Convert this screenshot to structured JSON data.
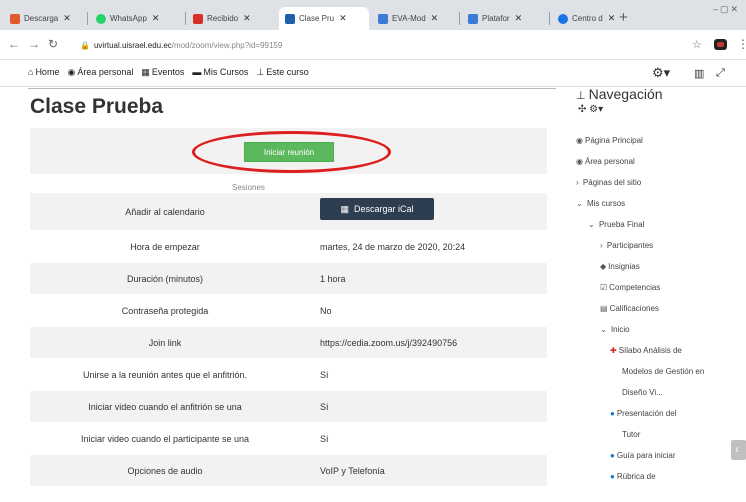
{
  "browser": {
    "tabs": [
      {
        "label": "Descarga",
        "color": "#e05a2b"
      },
      {
        "label": "WhatsApp",
        "color": "#25d366"
      },
      {
        "label": "Recibido",
        "color": "#d93025"
      },
      {
        "label": "Clase Pru",
        "color": "#1f5faa"
      },
      {
        "label": "EVA-Mod",
        "color": "#3a7bd5"
      },
      {
        "label": "Platafor",
        "color": "#3a7bd5"
      },
      {
        "label": "Centro d",
        "color": "#1a73e8"
      }
    ],
    "url_host": "uvirtual.uisrael.edu.ec",
    "url_path": "/mod/zoom/view.php?id=99159"
  },
  "sitenav": {
    "items": [
      {
        "icon": "home-icon",
        "label": "Home"
      },
      {
        "icon": "dashboard-icon",
        "label": "Área personal"
      },
      {
        "icon": "calendar-icon",
        "label": "Eventos"
      },
      {
        "icon": "courses-icon",
        "label": "Mis Cursos"
      },
      {
        "icon": "sitemap-icon",
        "label": "Este curso"
      }
    ]
  },
  "main": {
    "title": "Clase Prueba",
    "start_button": "Iniciar reunión",
    "sessions_label": "Sesiones",
    "ical_button": "Descargar iCal",
    "rows": [
      {
        "label": "Añadir al calendario",
        "value": ""
      },
      {
        "label": "Hora de empezar",
        "value": "martes, 24 de marzo de 2020, 20:24"
      },
      {
        "label": "Duración (minutos)",
        "value": "1 hora"
      },
      {
        "label": "Contraseña protegida",
        "value": "No"
      },
      {
        "label": "Join link",
        "value": "https://cedia.zoom.us/j/392490756"
      },
      {
        "label": "Unirse a la reunión antes que el anfitrión.",
        "value": "Sí"
      },
      {
        "label": "Iniciar video cuando el anfitrión se una",
        "value": "Sí"
      },
      {
        "label": "Iniciar video cuando el participante se una",
        "value": "Sí"
      },
      {
        "label": "Opciones de audio",
        "value": "VoIP y Telefonía"
      }
    ]
  },
  "sidebar": {
    "title": "Navegación",
    "items": [
      {
        "label": "Página Principal"
      },
      {
        "label": "Área personal"
      },
      {
        "label": "Páginas del sitio"
      },
      {
        "label": "Mis cursos"
      },
      {
        "label": "Prueba Final"
      },
      {
        "label": "Participantes"
      },
      {
        "label": "Insignias"
      },
      {
        "label": "Competencias"
      },
      {
        "label": "Calificaciones"
      },
      {
        "label": "Inicio"
      },
      {
        "label": "Sílabo Análisis de"
      },
      {
        "label": "Modelos de Gestión en"
      },
      {
        "label": "Diseño Vi..."
      },
      {
        "label": "Presentación del"
      },
      {
        "label": "Tutor"
      },
      {
        "label": "Guía para iniciar"
      },
      {
        "label": "Rúbrica de"
      }
    ]
  },
  "colors": {
    "highlight": "#dd1e1e",
    "start_button": "#5cb85c",
    "ical_button": "#2c3e50"
  }
}
